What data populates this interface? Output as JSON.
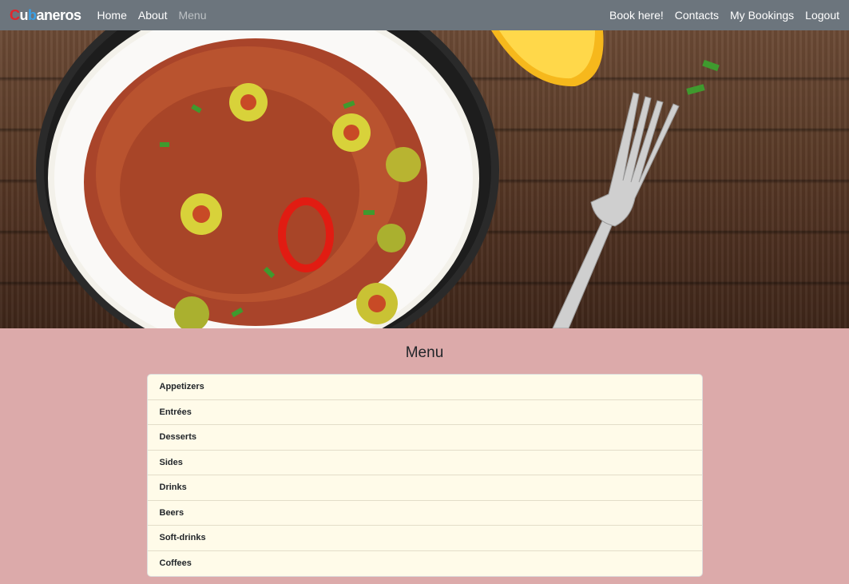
{
  "brand": {
    "letters": [
      "C",
      "u",
      "b",
      "aneros"
    ]
  },
  "nav": {
    "left": [
      {
        "label": "Home"
      },
      {
        "label": "About"
      },
      {
        "label": "Menu",
        "active": true
      }
    ],
    "right": [
      {
        "label": "Book here!"
      },
      {
        "label": "Contacts"
      },
      {
        "label": "My Bookings"
      },
      {
        "label": "Logout"
      }
    ]
  },
  "colors": {
    "navbar": "#6c757d",
    "page_background": "#dcaaaa",
    "menu_background": "#fffbe9"
  },
  "hero": {
    "icon": "food-photo-plate-of-ropa-vieja-with-rice-and-fork"
  },
  "menu": {
    "title": "Menu",
    "items": [
      "Appetizers",
      "Entrées",
      "Desserts",
      "Sides",
      "Drinks",
      "Beers",
      "Soft-drinks",
      "Coffees"
    ]
  }
}
